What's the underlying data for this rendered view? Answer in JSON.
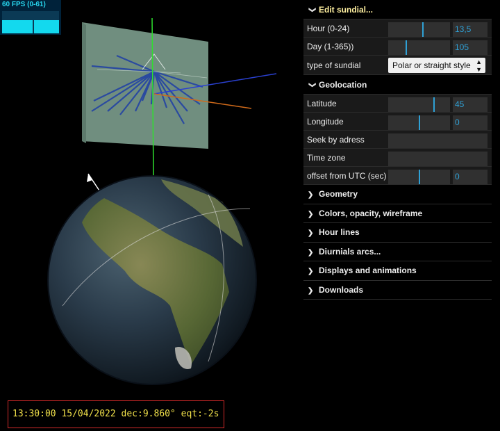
{
  "fps": {
    "label": "60 FPS (0-61)",
    "level": 0.6
  },
  "gui": {
    "edit_folder": "Edit sundial...",
    "hour": {
      "label": "Hour  (0-24)",
      "value": "13,5",
      "fraction": 0.5625
    },
    "day": {
      "label": "Day (1-365))",
      "value": "105",
      "fraction": 0.29
    },
    "sundial_type": {
      "label": "type of sundial",
      "value": "Polar or straight style",
      "arrows": "▲▼"
    },
    "geolocation_folder": "Geolocation",
    "latitude": {
      "label": "Latitude",
      "value": "45",
      "fraction": 0.75
    },
    "longitude": {
      "label": "Longitude",
      "value": "0",
      "fraction": 0.5
    },
    "seek_address": {
      "label": "Seek by adress",
      "value": ""
    },
    "time_zone": {
      "label": "Time zone",
      "value": ""
    },
    "utc_offset": {
      "label": "offset from UTC (sec)",
      "value": "0",
      "fraction": 0.5
    },
    "folders": [
      {
        "label": "Geometry"
      },
      {
        "label": "Colors, opacity, wireframe"
      },
      {
        "label": "Hour lines"
      },
      {
        "label": "Diurnials arcs..."
      },
      {
        "label": "Displays and animations"
      },
      {
        "label": "Downloads"
      }
    ],
    "chevron_open": "❯",
    "chevron_closed": "❯"
  },
  "status": {
    "text": "13:30:00 15/04/2022 dec:9.860° eqt:-2s"
  },
  "colors": {
    "accent": "#2fa1d6",
    "status_text": "#f0e04a",
    "status_border": "#d42a2a",
    "fps": "#13d9ee"
  }
}
